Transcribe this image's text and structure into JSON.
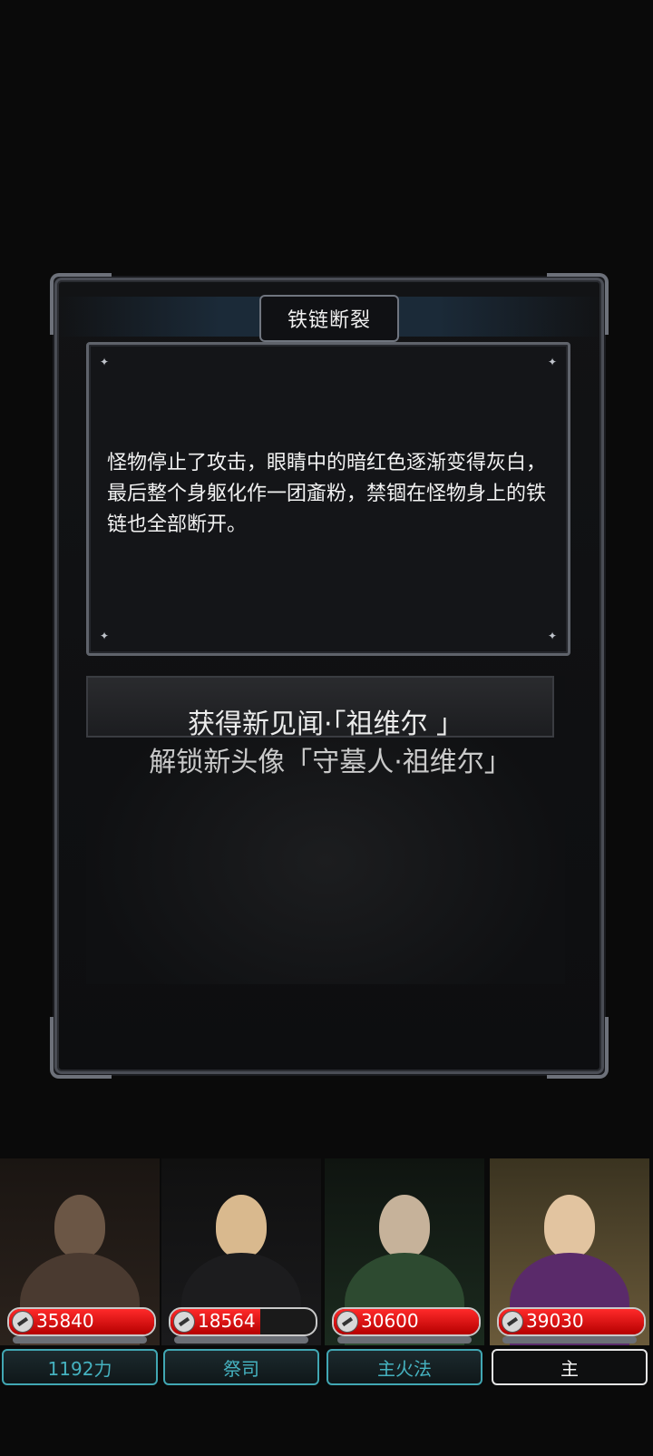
{
  "event": {
    "title": "铁链断裂",
    "description": "怪物停止了攻击，眼睛中的暗红色逐渐变得灰白，最后整个身躯化作一团齑粉，禁锢在怪物身上的铁链也全部断开。",
    "reward_line1": "获得新见闻·「祖维尔 」",
    "reward_line2": "解锁新头像「守墓人·祖维尔」"
  },
  "party": [
    {
      "hp": "35840",
      "hp_fraction": 1.0,
      "label": "1192力",
      "label_style": "cyan"
    },
    {
      "hp": "18564",
      "hp_fraction": 0.62,
      "label": "祭司",
      "label_style": "cyan"
    },
    {
      "hp": "30600",
      "hp_fraction": 1.0,
      "label": "主火法",
      "label_style": "cyan"
    },
    {
      "hp": "39030",
      "hp_fraction": 1.0,
      "label": "主",
      "label_style": "white"
    }
  ],
  "colors": {
    "hp_red": "#d40000",
    "label_cyan": "#45b2c0"
  }
}
